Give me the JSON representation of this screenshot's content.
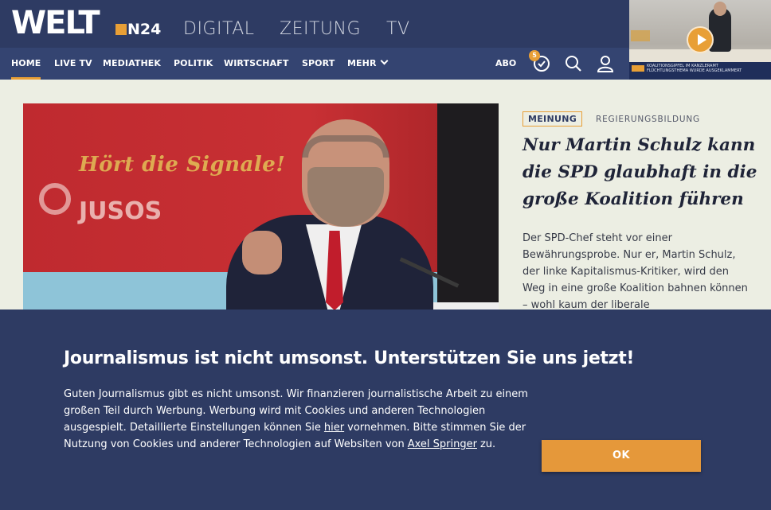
{
  "brand": {
    "logo": "WELT",
    "n24": "N24",
    "links": [
      "DIGITAL",
      "ZEITUNG",
      "TV"
    ]
  },
  "nav": {
    "items": [
      "HOME",
      "LIVE TV",
      "MEDIATHEK",
      "POLITIK",
      "WIRTSCHAFT",
      "SPORT",
      "MEHR"
    ],
    "active": "HOME",
    "abo": "ABO",
    "badge_count": "5",
    "icons": [
      "history-icon",
      "search-icon",
      "user-icon",
      "chevron-down-icon"
    ]
  },
  "video": {
    "ticker_line1": "KOALITIONSGIPFEL IM KANZLERAMT",
    "ticker_line2": "FLÜCHTLINGSTHEMA WURDE AUSGEKLAMMERT",
    "icons": [
      "play-icon"
    ]
  },
  "article": {
    "tag": "MEINUNG",
    "topic": "REGIERUNGSBILDUNG",
    "headline": "Nur Martin Schulz kann die SPD glaubhaft in die große Koalition führen",
    "teaser": "Der SPD-Chef steht vor einer Bewährungsprobe. Nur er, Martin Schulz, der linke Kapitalismus-Kritiker, wird den Weg in eine große Koalition bahnen können – wohl kaum der liberale",
    "image_sign_text": "Hört die Signale!",
    "image_sign_logo": "JUSOS"
  },
  "consent": {
    "title": "Journalismus ist nicht umsonst. Unterstützen Sie uns jetzt!",
    "text_part1": "Guten Journalismus gibt es nicht umsonst. Wir finanzieren journalistische Arbeit zu einem großen Teil durch Werbung. Werbung wird mit Cookies und anderen Technologien ausgespielt. Detaillierte Einstellungen können Sie",
    "link_hier": "hier",
    "text_part2": "vornehmen. Bitte stimmen Sie der Nutzung von Cookies und anderer Technologien auf Websiten von",
    "link_axel": "Axel Springer",
    "text_part3": "zu.",
    "ok_label": "OK"
  },
  "colors": {
    "header_bg": "#2e3b63",
    "nav_bg": "#344471",
    "accent": "#e89f36",
    "page_bg": "#eceee3"
  }
}
